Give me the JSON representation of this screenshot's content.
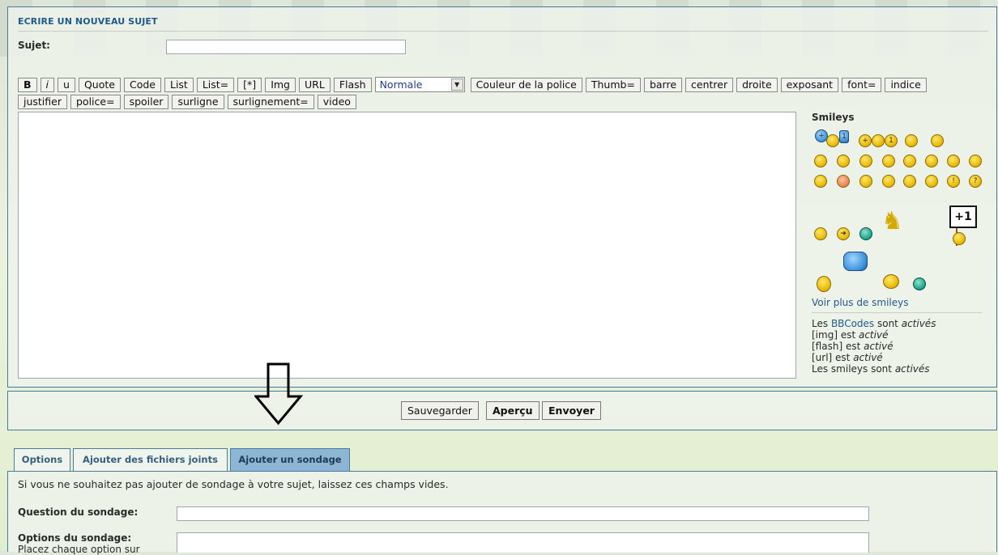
{
  "section_title": "ECRIRE UN NOUVEAU SUJET",
  "subject": {
    "label": "Sujet:",
    "value": ""
  },
  "toolbar_row1": [
    "B",
    "i",
    "u",
    "Quote",
    "Code",
    "List",
    "List=",
    "[*]",
    "Img",
    "URL",
    "Flash"
  ],
  "font_size_select": {
    "selected": "Normale"
  },
  "toolbar_row1b": [
    "Couleur de la police",
    "Thumb=",
    "barre",
    "centrer",
    "droite",
    "exposant",
    "font=",
    "indice"
  ],
  "toolbar_row2": [
    "justifier",
    "police=",
    "spoiler",
    "surligne",
    "surlignement=",
    "video"
  ],
  "smileys": {
    "title": "Smileys",
    "more_link": "Voir plus de smileys",
    "sign_text": "+1"
  },
  "status": {
    "bbcodes_pre": "Les ",
    "bbcodes_link": "BBCodes",
    "bbcodes_mid": " sont ",
    "bbcodes_state": "activés",
    "img_pre": "[img] est ",
    "img_state": "activé",
    "flash_pre": "[flash] est ",
    "flash_state": "activé",
    "url_pre": "[url] est ",
    "url_state": "activé",
    "smileys_pre": "Les smileys sont ",
    "smileys_state": "activés"
  },
  "actions": {
    "save": "Sauvegarder",
    "preview": "Aperçu",
    "send": "Envoyer"
  },
  "tabs": [
    {
      "label": "Options"
    },
    {
      "label": "Ajouter des fichiers joints"
    },
    {
      "label": "Ajouter un sondage"
    }
  ],
  "poll": {
    "intro": "Si vous ne souhaitez pas ajouter de sondage à votre sujet, laissez ces champs vides.",
    "question_label": "Question du sondage:",
    "options_label": "Options du sondage:",
    "options_hint": "Placez chaque option sur"
  },
  "colors": {
    "accent": "#1e5b8c",
    "border": "#4a7a9c",
    "active_tab": "#8db5d4"
  }
}
